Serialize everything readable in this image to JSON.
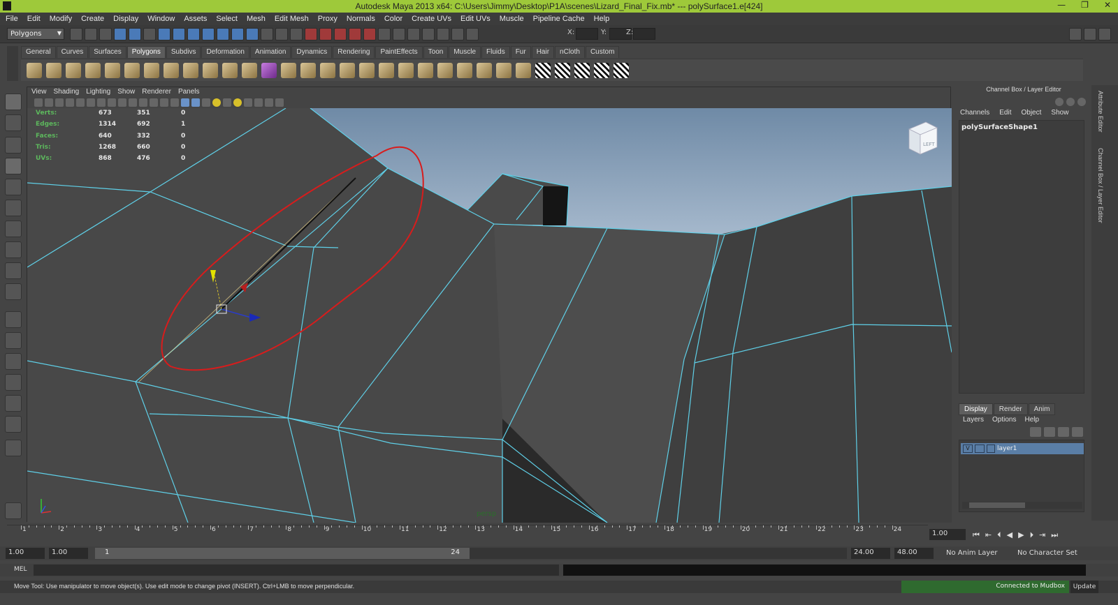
{
  "window": {
    "title": "Autodesk Maya 2013 x64: C:\\Users\\Jimmy\\Desktop\\P1A\\scenes\\Lizard_Final_Fix.mb*   ---   polySurface1.e[424]",
    "minimize": "—",
    "restore": "❐",
    "close": "✕"
  },
  "menu": [
    "File",
    "Edit",
    "Modify",
    "Create",
    "Display",
    "Window",
    "Assets",
    "Select",
    "Mesh",
    "Edit Mesh",
    "Proxy",
    "Normals",
    "Color",
    "Create UVs",
    "Edit UVs",
    "Muscle",
    "Pipeline Cache",
    "Help"
  ],
  "statusline": {
    "mode": "Polygons",
    "x_label": "X:",
    "y_label": "Y:",
    "z_label": "Z:"
  },
  "shelf": {
    "tabs": [
      "General",
      "Curves",
      "Surfaces",
      "Polygons",
      "Subdivs",
      "Deformation",
      "Animation",
      "Dynamics",
      "Rendering",
      "PaintEffects",
      "Toon",
      "Muscle",
      "Fluids",
      "Fur",
      "Hair",
      "nCloth",
      "Custom"
    ],
    "active_tab": "Polygons"
  },
  "viewport": {
    "menu": [
      "View",
      "Shading",
      "Lighting",
      "Show",
      "Renderer",
      "Panels"
    ],
    "camera": "persp",
    "view_cube_label": "LEFT",
    "hud": [
      {
        "label": "Verts:",
        "v1": "673",
        "v2": "351",
        "v3": "0"
      },
      {
        "label": "Edges:",
        "v1": "1314",
        "v2": "692",
        "v3": "1"
      },
      {
        "label": "Faces:",
        "v1": "640",
        "v2": "332",
        "v3": "0"
      },
      {
        "label": "Tris:",
        "v1": "1268",
        "v2": "660",
        "v3": "0"
      },
      {
        "label": "UVs:",
        "v1": "868",
        "v2": "476",
        "v3": "0"
      }
    ]
  },
  "channel_box": {
    "title": "Channel Box / Layer Editor",
    "menu": [
      "Channels",
      "Edit",
      "Object",
      "Show"
    ],
    "object_name": "polySurfaceShape1"
  },
  "layer_editor": {
    "tabs": [
      "Display",
      "Render",
      "Anim"
    ],
    "active_tab": "Display",
    "menu": [
      "Layers",
      "Options",
      "Help"
    ],
    "layers": [
      {
        "visible": "V",
        "name": "layer1"
      }
    ]
  },
  "side_tabs": [
    "Attribute Editor",
    "Channel Box / Layer Editor"
  ],
  "timeline": {
    "frames": [
      "1",
      "2",
      "3",
      "4",
      "5",
      "6",
      "7",
      "8",
      "9",
      "10",
      "11",
      "12",
      "13",
      "14",
      "15",
      "16",
      "17",
      "18",
      "19",
      "20",
      "21",
      "22",
      "23",
      "24"
    ],
    "current_frame": "1.00"
  },
  "range": {
    "start": "1.00",
    "playback_start": "1.00",
    "slider_start": "1",
    "slider_end": "24",
    "playback_end": "24.00",
    "end": "48.00",
    "anim_layer": "No Anim Layer",
    "character_set": "No Character Set"
  },
  "command": {
    "label": "MEL"
  },
  "helpline": {
    "text": "Move Tool: Use manipulator to move object(s). Use edit mode to change pivot (INSERT). Ctrl+LMB to move perpendicular.",
    "mudbox": "Connected to Mudbox",
    "update": "Update"
  },
  "colors": {
    "title_bar": "#9ec93a",
    "wire": "#5fd0e8",
    "annotation": "#d81c1c",
    "sky": "#7e9bb7",
    "selected_layer": "#5a7ea6"
  }
}
